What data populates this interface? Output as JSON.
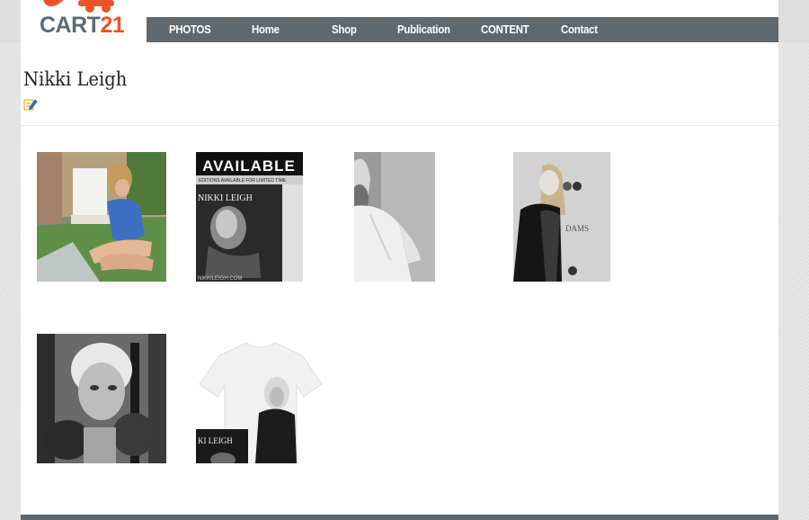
{
  "logo": {
    "brand_letters": "CART",
    "brand_number": "21",
    "colors": {
      "text": "#5b6b77",
      "accent": "#e8552b"
    }
  },
  "nav": {
    "items": [
      {
        "label": "PHOTOS"
      },
      {
        "label": "Home"
      },
      {
        "label": "Shop"
      },
      {
        "label": "Publication"
      },
      {
        "label": "CONTENT"
      },
      {
        "label": "Contact"
      }
    ],
    "background": "#5f676f"
  },
  "page": {
    "title": "Nikki Leigh",
    "edit_icon": "edit-pencil-icon"
  },
  "gallery": {
    "items": [
      {
        "name": "photo-blue-swimsuit-poolside",
        "tone": "color"
      },
      {
        "name": "photo-available-poster",
        "tone": "grayscale",
        "text_available": "AVAILABLE",
        "text_sub": "EDITIONS AVAILABLE FOR LIMITED TIME",
        "text_name": "NIKKI LEIGH",
        "text_url": "NIKKILEIGH.COM"
      },
      {
        "name": "photo-white-shirt",
        "tone": "grayscale"
      },
      {
        "name": "photo-event-backdrop",
        "tone": "grayscale",
        "text_backdrop": "DAMS"
      },
      {
        "name": "photo-boxing-gloves",
        "tone": "grayscale"
      },
      {
        "name": "photo-tshirt-print",
        "tone": "grayscale",
        "text_name": "KI LEIGH"
      }
    ]
  }
}
